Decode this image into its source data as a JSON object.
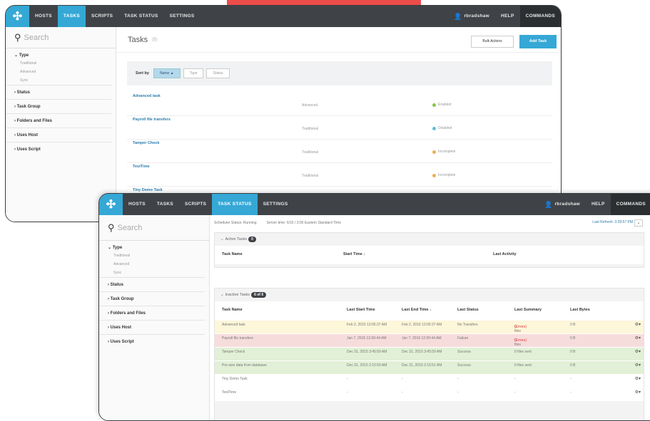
{
  "colors": {
    "accent_red": "#ec4c4a",
    "brand_blue": "#35a8d6",
    "topbar": "#3f4347",
    "row_warning": "#fdf6d9",
    "row_failure": "#f7dcdc",
    "row_success": "#e1f0d6"
  },
  "app": {
    "logo_icon": "goanywhere-logo-icon",
    "nav": [
      "HOSTS",
      "TASKS",
      "SCRIPTS",
      "TASK STATUS",
      "SETTINGS"
    ],
    "user": "rbradshaw",
    "help": "HELP",
    "commands": "COMMANDS"
  },
  "sidebar": {
    "search_placeholder": "Search",
    "type_heading": "Type",
    "type_options": [
      "Traditional",
      "Advanced",
      "Sync"
    ],
    "facets": [
      "Status",
      "Task Group",
      "Folders and Files",
      "Uses Host",
      "Uses Script"
    ]
  },
  "tasks_page": {
    "title": "Tasks",
    "count": "(5)",
    "bulk_actions": "Bulk Actions",
    "add_task": "Add Task",
    "sort_by": "Sort by",
    "sort_options": [
      "Name ▲",
      "Type",
      "Status"
    ],
    "tasks": [
      {
        "name": "Advanced task",
        "type": "Advanced",
        "status": "Enabled",
        "status_color": "#8bc34a"
      },
      {
        "name": "Payroll file transfers",
        "type": "Traditional",
        "status": "Disabled",
        "status_color": "#5bc0de"
      },
      {
        "name": "Tamper Check",
        "type": "Traditional",
        "status": "Incomplete",
        "status_color": "#f0ad4e"
      },
      {
        "name": "TestTime",
        "type": "Traditional",
        "status": "Incomplete",
        "status_color": "#f0ad4e"
      },
      {
        "name": "Tiny Demo Task",
        "type": "",
        "status": "",
        "status_color": "#f0ad4e"
      }
    ]
  },
  "status_page": {
    "scheduler": "Scheduler Status: Running",
    "server_time": "Server time: 6/15 / 3:00 Eastern Standard Time",
    "last_refresh": "Last Refresh: 3:29:57 PM",
    "active_title": "Active Tasks",
    "active_count": "0",
    "active_headers": [
      "Task Name",
      "Start Time ↓",
      "Last Activity"
    ],
    "inactive_title": "Inactive Tasks",
    "inactive_count": "6 of 6",
    "inactive_headers": [
      "Task Name",
      "Last Start Time",
      "Last End Time ↓",
      "Last Status",
      "Last Summary",
      "Last Bytes"
    ],
    "rows": [
      {
        "name": "Advanced task",
        "start": "Feb 2, 2016 13:05:37 AM",
        "end": "Feb 2, 2016 13:05:37 AM",
        "status": "No Transfers",
        "summary": "0 files sent",
        "summary_err": "(Errors)",
        "bytes": "0 B",
        "style": "warning"
      },
      {
        "name": "Payroll file transfers",
        "start": "Jan 7, 2016 12:00:44 AM",
        "end": "Jan 7, 2016 12:00:44 AM",
        "status": "Failure",
        "summary": "0 files sent",
        "summary_err": "(Errors)",
        "bytes": "0 B",
        "style": "failure"
      },
      {
        "name": "Tamper Check",
        "start": "Dec 31, 2015 3:45:59 AM",
        "end": "Dec 31, 2015 3:45:59 AM",
        "status": "Success",
        "summary": "0 files sent",
        "summary_err": "",
        "bytes": "0 B",
        "style": "success"
      },
      {
        "name": "Pre-size data from database",
        "start": "Dec 31, 2015 2:15:50 AM",
        "end": "Dec 31, 2015 2:15:51 AM",
        "status": "Success",
        "summary": "0 files sent",
        "summary_err": "",
        "bytes": "0 B",
        "style": "success"
      },
      {
        "name": "Tiny Demo Task",
        "start": "-",
        "end": "-",
        "status": "-",
        "summary": "-",
        "summary_err": "",
        "bytes": "-",
        "style": "plain"
      },
      {
        "name": "TestTime",
        "start": "-",
        "end": "-",
        "status": "-",
        "summary": "-",
        "summary_err": "",
        "bytes": "-",
        "style": "plain"
      }
    ]
  }
}
